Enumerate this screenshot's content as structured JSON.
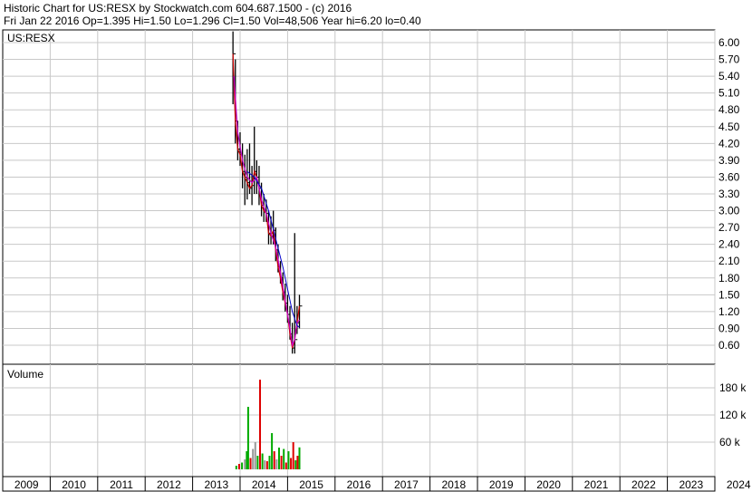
{
  "header": {
    "title": "Historic Chart for US:RESX by Stockwatch.com 604.687.1500 - (c) 2016",
    "quote": "Fri Jan 22 2016   Op=1.395  Hi=1.50  Lo=1.296  Cl=1.50  Vol=48,506  Year hi=6.20  lo=0.40"
  },
  "chart_data": {
    "type": "candlestick",
    "symbol_label": "US:RESX",
    "volume_label": "Volume",
    "price_ticks": [
      "6.00",
      "5.70",
      "5.40",
      "5.10",
      "4.80",
      "4.50",
      "4.20",
      "3.90",
      "3.60",
      "3.30",
      "3.00",
      "2.70",
      "2.40",
      "2.10",
      "1.80",
      "1.50",
      "1.20",
      "0.90",
      "0.60"
    ],
    "volume_ticks": [
      "180 k",
      "120 k",
      "60 k"
    ],
    "x_ticks": [
      "2009",
      "2010",
      "2011",
      "2012",
      "2013",
      "2014",
      "2015",
      "2016",
      "2017",
      "2018",
      "2019",
      "2020",
      "2021",
      "2022",
      "2023",
      "2024"
    ],
    "price_range": [
      0.4,
      6.25
    ],
    "volume_range": [
      0,
      240000
    ],
    "grid": true,
    "colors": {
      "price_bar": "#000000",
      "close_line": "#cc0000",
      "ma_short": "#cc00cc",
      "ma_long": "#0000cc",
      "volume_up": "#00aa00",
      "volume_down": "#dd0000",
      "volume_neutral": "#999999"
    },
    "price_series": [
      {
        "date": "2013.85",
        "high": 6.2,
        "low": 4.9,
        "close": 5.8
      },
      {
        "date": "2013.90",
        "high": 5.7,
        "low": 4.2,
        "close": 4.6
      },
      {
        "date": "2013.95",
        "high": 4.6,
        "low": 3.9,
        "close": 4.1
      },
      {
        "date": "2014.00",
        "high": 4.4,
        "low": 3.8,
        "close": 4.0
      },
      {
        "date": "2014.05",
        "high": 4.2,
        "low": 3.4,
        "close": 3.7
      },
      {
        "date": "2014.10",
        "high": 4.0,
        "low": 3.1,
        "close": 3.6
      },
      {
        "date": "2014.15",
        "high": 4.1,
        "low": 3.2,
        "close": 3.5
      },
      {
        "date": "2014.20",
        "high": 4.2,
        "low": 3.3,
        "close": 3.4
      },
      {
        "date": "2014.25",
        "high": 3.8,
        "low": 3.1,
        "close": 3.45
      },
      {
        "date": "2014.30",
        "high": 4.5,
        "low": 3.3,
        "close": 3.7
      },
      {
        "date": "2014.35",
        "high": 3.9,
        "low": 3.3,
        "close": 3.6
      },
      {
        "date": "2014.40",
        "high": 3.8,
        "low": 3.1,
        "close": 3.4
      },
      {
        "date": "2014.45",
        "high": 3.5,
        "low": 2.9,
        "close": 3.1
      },
      {
        "date": "2014.50",
        "high": 3.3,
        "low": 2.8,
        "close": 3.0
      },
      {
        "date": "2014.55",
        "high": 3.2,
        "low": 2.8,
        "close": 2.95
      },
      {
        "date": "2014.60",
        "high": 3.0,
        "low": 2.4,
        "close": 2.6
      },
      {
        "date": "2014.65",
        "high": 2.9,
        "low": 2.4,
        "close": 2.55
      },
      {
        "date": "2014.70",
        "high": 3.0,
        "low": 2.4,
        "close": 2.65
      },
      {
        "date": "2014.75",
        "high": 2.7,
        "low": 2.1,
        "close": 2.3
      },
      {
        "date": "2014.80",
        "high": 2.4,
        "low": 1.9,
        "close": 2.0
      },
      {
        "date": "2014.85",
        "high": 2.1,
        "low": 1.7,
        "close": 1.8
      },
      {
        "date": "2014.90",
        "high": 1.9,
        "low": 1.4,
        "close": 1.55
      },
      {
        "date": "2014.95",
        "high": 1.7,
        "low": 1.2,
        "close": 1.35
      },
      {
        "date": "2015.00",
        "high": 1.5,
        "low": 1.0,
        "close": 1.15
      },
      {
        "date": "2015.05",
        "high": 1.3,
        "low": 0.7,
        "close": 0.8
      },
      {
        "date": "2015.10",
        "high": 1.0,
        "low": 0.45,
        "close": 0.55
      },
      {
        "date": "2015.15",
        "high": 2.6,
        "low": 0.45,
        "close": 0.7
      },
      {
        "date": "2015.20",
        "high": 1.3,
        "low": 0.8,
        "close": 1.0
      },
      {
        "date": "2015.25",
        "high": 1.5,
        "low": 0.9,
        "close": 1.3
      }
    ],
    "ma_short": [
      {
        "date": "2013.87",
        "value": 5.4
      },
      {
        "date": "2013.95",
        "value": 4.4
      },
      {
        "date": "2014.05",
        "value": 3.9
      },
      {
        "date": "2014.15",
        "value": 3.6
      },
      {
        "date": "2014.25",
        "value": 3.5
      },
      {
        "date": "2014.35",
        "value": 3.6
      },
      {
        "date": "2014.45",
        "value": 3.2
      },
      {
        "date": "2014.55",
        "value": 2.95
      },
      {
        "date": "2014.65",
        "value": 2.6
      },
      {
        "date": "2014.75",
        "value": 2.35
      },
      {
        "date": "2014.85",
        "value": 1.9
      },
      {
        "date": "2014.95",
        "value": 1.4
      },
      {
        "date": "2015.05",
        "value": 0.9
      },
      {
        "date": "2015.10",
        "value": 0.6
      },
      {
        "date": "2015.15",
        "value": 0.7
      },
      {
        "date": "2015.20",
        "value": 1.0
      },
      {
        "date": "2015.25",
        "value": 1.05
      }
    ],
    "ma_long": [
      {
        "date": "2014.15",
        "value": 3.7
      },
      {
        "date": "2014.30",
        "value": 3.6
      },
      {
        "date": "2014.45",
        "value": 3.4
      },
      {
        "date": "2014.60",
        "value": 3.0
      },
      {
        "date": "2014.75",
        "value": 2.5
      },
      {
        "date": "2014.90",
        "value": 2.0
      },
      {
        "date": "2015.00",
        "value": 1.6
      },
      {
        "date": "2015.10",
        "value": 1.2
      },
      {
        "date": "2015.20",
        "value": 0.95
      },
      {
        "date": "2015.25",
        "value": 0.92
      }
    ],
    "volume_series": [
      {
        "date": "2013.92",
        "value": 8000,
        "dir": "up"
      },
      {
        "date": "2013.98",
        "value": 12000,
        "dir": "down"
      },
      {
        "date": "2014.04",
        "value": 15000,
        "dir": "up"
      },
      {
        "date": "2014.10",
        "value": 22000,
        "dir": "neutral"
      },
      {
        "date": "2014.14",
        "value": 40000,
        "dir": "up"
      },
      {
        "date": "2014.17",
        "value": 138000,
        "dir": "up"
      },
      {
        "date": "2014.22",
        "value": 25000,
        "dir": "down"
      },
      {
        "date": "2014.27",
        "value": 45000,
        "dir": "neutral"
      },
      {
        "date": "2014.32",
        "value": 60000,
        "dir": "neutral"
      },
      {
        "date": "2014.37",
        "value": 30000,
        "dir": "up"
      },
      {
        "date": "2014.42",
        "value": 198000,
        "dir": "down"
      },
      {
        "date": "2014.47",
        "value": 35000,
        "dir": "up"
      },
      {
        "date": "2014.52",
        "value": 20000,
        "dir": "neutral"
      },
      {
        "date": "2014.57",
        "value": 18000,
        "dir": "down"
      },
      {
        "date": "2014.62",
        "value": 30000,
        "dir": "up"
      },
      {
        "date": "2014.67",
        "value": 80000,
        "dir": "up"
      },
      {
        "date": "2014.72",
        "value": 40000,
        "dir": "down"
      },
      {
        "date": "2014.77",
        "value": 22000,
        "dir": "neutral"
      },
      {
        "date": "2014.82",
        "value": 48000,
        "dir": "up"
      },
      {
        "date": "2014.87",
        "value": 30000,
        "dir": "down"
      },
      {
        "date": "2014.92",
        "value": 45000,
        "dir": "up"
      },
      {
        "date": "2014.97",
        "value": 15000,
        "dir": "down"
      },
      {
        "date": "2015.02",
        "value": 40000,
        "dir": "up"
      },
      {
        "date": "2015.07",
        "value": 25000,
        "dir": "down"
      },
      {
        "date": "2015.12",
        "value": 60000,
        "dir": "down"
      },
      {
        "date": "2015.17",
        "value": 20000,
        "dir": "up"
      },
      {
        "date": "2015.21",
        "value": 30000,
        "dir": "down"
      },
      {
        "date": "2015.25",
        "value": 48506,
        "dir": "up"
      }
    ]
  }
}
